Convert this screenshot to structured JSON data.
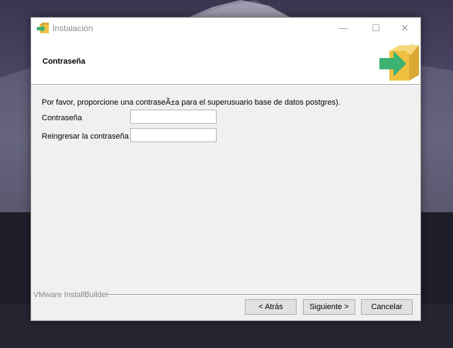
{
  "window": {
    "title": "Instalación",
    "minimize_glyph": "—",
    "maximize_glyph": "☐",
    "close_glyph": "✕"
  },
  "header": {
    "title": "Contraseña",
    "icon": "installer-box-arrow-icon"
  },
  "content": {
    "intro": "Por favor, proporcione una contraseÃ±a para el superusuario base de datos postgres).",
    "fields": [
      {
        "label": "Contraseña",
        "value": ""
      },
      {
        "label": "Reingresar la contraseña",
        "value": ""
      }
    ]
  },
  "footer": {
    "brand": "VMware InstallBuilder",
    "back_label": "< Atrás",
    "next_label": "Siguiente >",
    "cancel_label": "Cancelar"
  },
  "colors": {
    "box": "#f0c040",
    "arrow": "#3cb371"
  }
}
